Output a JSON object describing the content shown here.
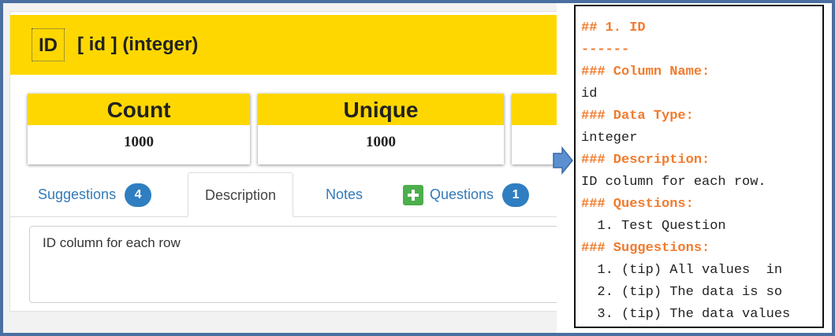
{
  "header": {
    "id_badge": "ID",
    "title": "[ id ] (integer)"
  },
  "cards": [
    {
      "label": "Count",
      "value": "1000"
    },
    {
      "label": "Unique",
      "value": "1000"
    }
  ],
  "tabs": {
    "suggestions": {
      "label": "Suggestions",
      "count": "4"
    },
    "description": {
      "label": "Description"
    },
    "notes": {
      "label": "Notes"
    },
    "questions": {
      "label": "Questions",
      "count": "1"
    }
  },
  "description_text": "ID column for each row",
  "markdown": {
    "lines": [
      {
        "text": "## 1. ID",
        "heading": true
      },
      {
        "text": "------",
        "heading": true
      },
      {
        "text": "### Column Name:",
        "heading": true
      },
      {
        "text": "id",
        "heading": false
      },
      {
        "text": "### Data Type:",
        "heading": true
      },
      {
        "text": "integer",
        "heading": false
      },
      {
        "text": "### Description:",
        "heading": true
      },
      {
        "text": "ID column for each row.",
        "heading": false
      },
      {
        "text": "### Questions:",
        "heading": true
      },
      {
        "text": "  1. Test Question",
        "heading": false
      },
      {
        "text": "### Suggestions:",
        "heading": true
      },
      {
        "text": "  1. (tip) All values  in",
        "heading": false
      },
      {
        "text": "  2. (tip) The data is so",
        "heading": false
      },
      {
        "text": "  3. (tip) The data values",
        "heading": false
      }
    ]
  },
  "colors": {
    "header_yellow": "#ffd700",
    "frame_blue": "#4a6fa0",
    "markdown_heading_orange": "#f07b2e",
    "badge_blue": "#2f7ec1",
    "plus_green": "#4cae4c"
  }
}
